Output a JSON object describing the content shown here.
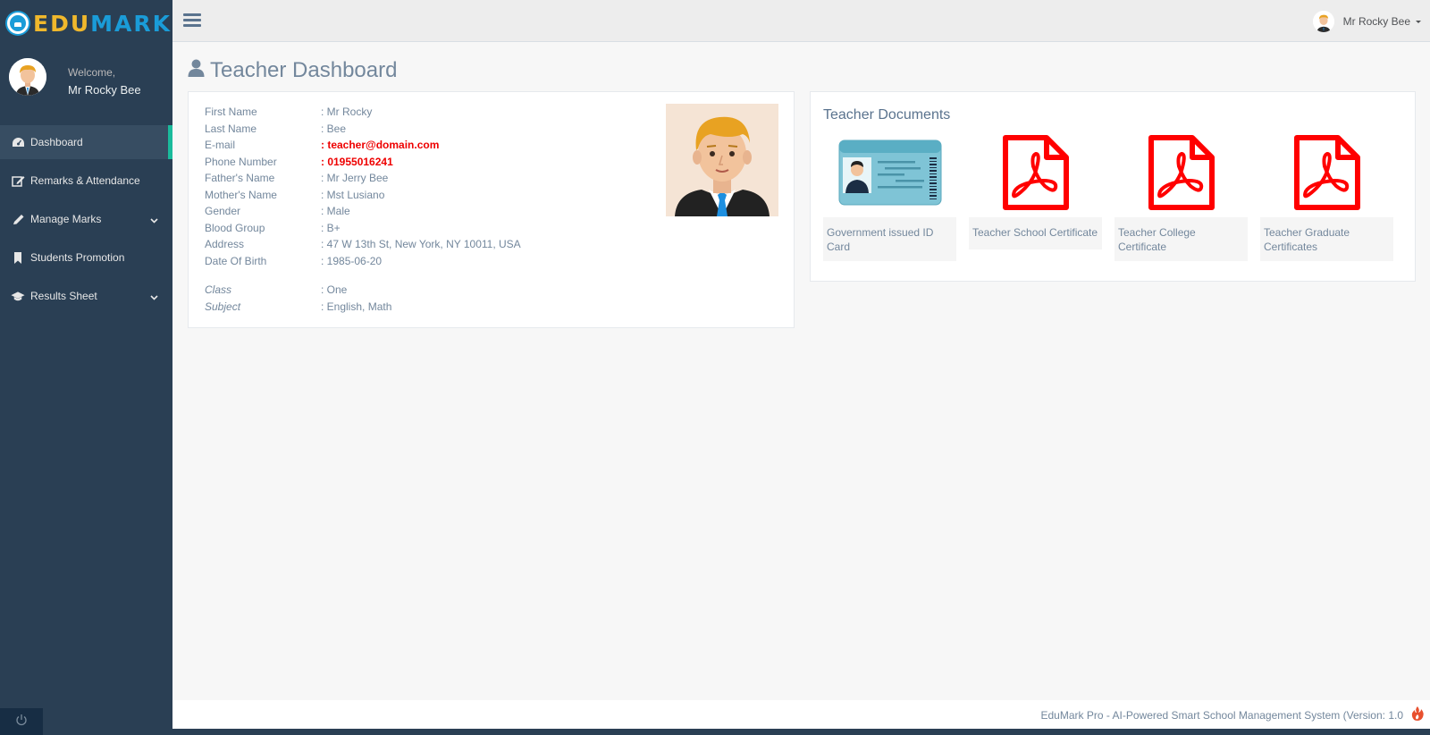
{
  "brand": {
    "edu": "EDU",
    "mark": "MARK"
  },
  "sidebar": {
    "welcome": "Welcome,",
    "user_name": "Mr Rocky Bee",
    "items": [
      {
        "label": "Dashboard",
        "icon": "dashboard-icon",
        "active": true
      },
      {
        "label": "Remarks & Attendance",
        "icon": "edit-icon"
      },
      {
        "label": "Manage Marks",
        "icon": "pencil-icon",
        "has_submenu": true
      },
      {
        "label": "Students Promotion",
        "icon": "bookmark-icon"
      },
      {
        "label": "Results Sheet",
        "icon": "graduation-cap-icon",
        "has_submenu": true
      }
    ]
  },
  "topbar": {
    "user_name": "Mr Rocky Bee"
  },
  "page": {
    "title": "Teacher Dashboard"
  },
  "teacher": {
    "rows": [
      {
        "label": "First Name",
        "value": ": Mr Rocky"
      },
      {
        "label": "Last Name",
        "value": ": Bee"
      },
      {
        "label": "E-mail",
        "value": ": teacher@domain.com",
        "highlight": true
      },
      {
        "label": "Phone Number",
        "value": ": 01955016241",
        "highlight": true
      },
      {
        "label": "Father's Name",
        "value": ": Mr Jerry Bee"
      },
      {
        "label": "Mother's Name",
        "value": ": Mst Lusiano"
      },
      {
        "label": "Gender",
        "value": ": Male"
      },
      {
        "label": "Blood Group",
        "value": ": B+"
      },
      {
        "label": "Address",
        "value": ": 47 W 13th St, New York, NY 10011, USA"
      },
      {
        "label": "Date Of Birth",
        "value": ": 1985-06-20"
      }
    ],
    "extra_rows": [
      {
        "label": "Class",
        "value": ": One"
      },
      {
        "label": "Subject",
        "value": ": English, Math"
      }
    ]
  },
  "documents": {
    "title": "Teacher Documents",
    "id_card_label": "ID CARD",
    "items": [
      {
        "caption": "Government issued ID Card",
        "type": "id-card"
      },
      {
        "caption": "Teacher School Certificate",
        "type": "pdf"
      },
      {
        "caption": "Teacher College Certificate",
        "type": "pdf"
      },
      {
        "caption": "Teacher Graduate Certificates",
        "type": "pdf"
      }
    ]
  },
  "footer": {
    "text": "EduMark Pro - AI-Powered Smart School Management System (Version: 1.0"
  },
  "colors": {
    "sidebar": "#2a3f54",
    "accent": "#1abb9c",
    "highlight": "#ee0000",
    "pdf": "#ff0000"
  }
}
